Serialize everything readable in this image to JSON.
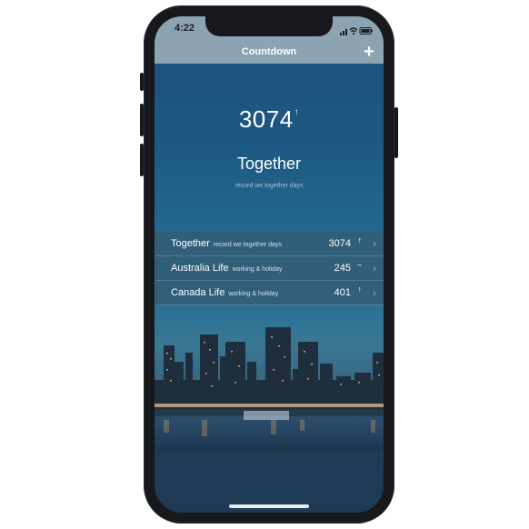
{
  "status_bar": {
    "time": "4:22"
  },
  "navbar": {
    "title": "Countdown",
    "add_label": "+"
  },
  "hero": {
    "number": "3074",
    "arrow": "↑",
    "title": "Together",
    "subtitle": "record we together days"
  },
  "list": [
    {
      "title": "Together",
      "subtitle": "record we together days",
      "value": "3074",
      "arrow": "↑"
    },
    {
      "title": "Australia Life",
      "subtitle": "working & holiday",
      "value": "245",
      "arrow": "–"
    },
    {
      "title": "Canada Life",
      "subtitle": "working & holiday",
      "value": "401",
      "arrow": "↑"
    }
  ],
  "icons": {
    "wifi": "wifi-icon",
    "battery": "battery-icon",
    "chevron": "chevron-right-icon",
    "add": "plus-icon"
  },
  "colors": {
    "bar": "#8ca3b2",
    "background_top": "#1d4e7a",
    "row": "#345c76"
  }
}
